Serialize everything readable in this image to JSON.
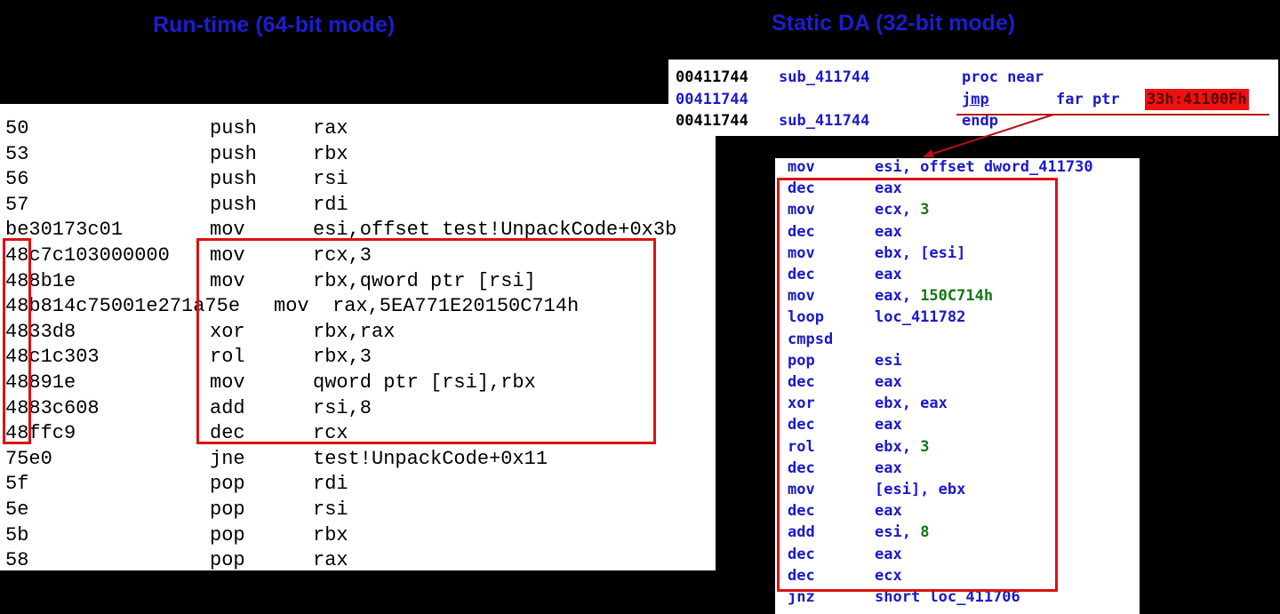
{
  "titles": {
    "left": "Run-time (64-bit mode)",
    "right": "Static DA (32-bit mode)"
  },
  "runtime_rows": [
    {
      "bytes": "50",
      "mnemonic": "push",
      "operands": "rax"
    },
    {
      "bytes": "53",
      "mnemonic": "push",
      "operands": "rbx"
    },
    {
      "bytes": "56",
      "mnemonic": "push",
      "operands": "rsi"
    },
    {
      "bytes": "57",
      "mnemonic": "push",
      "operands": "rdi"
    },
    {
      "bytes": "be30173c01",
      "mnemonic": "mov",
      "operands": "esi,offset test!UnpackCode+0x3b"
    },
    {
      "bytes": "48c7c103000000",
      "mnemonic": "mov",
      "operands": "rcx,3"
    },
    {
      "bytes": "488b1e",
      "mnemonic": "mov",
      "operands": "rbx,qword ptr [rsi]"
    },
    {
      "bytes": "48b814c75001e271a75e",
      "mnemonic": "mov",
      "operands": "rax,5EA771E20150C714h"
    },
    {
      "bytes": "4833d8",
      "mnemonic": "xor",
      "operands": "rbx,rax"
    },
    {
      "bytes": "48c1c303",
      "mnemonic": "rol",
      "operands": "rbx,3"
    },
    {
      "bytes": "48891e",
      "mnemonic": "mov",
      "operands": "qword ptr [rsi],rbx"
    },
    {
      "bytes": "4883c608",
      "mnemonic": "add",
      "operands": "rsi,8"
    },
    {
      "bytes": "48ffc9",
      "mnemonic": "dec",
      "operands": "rcx"
    },
    {
      "bytes": "75e0",
      "mnemonic": "jne",
      "operands": "test!UnpackCode+0x11"
    },
    {
      "bytes": "5f",
      "mnemonic": "pop",
      "operands": "rdi"
    },
    {
      "bytes": "5e",
      "mnemonic": "pop",
      "operands": "rsi"
    },
    {
      "bytes": "5b",
      "mnemonic": "pop",
      "operands": "rbx"
    },
    {
      "bytes": "58",
      "mnemonic": "pop",
      "operands": "rax"
    }
  ],
  "ida_top_rows": [
    {
      "addr": "00411744",
      "label": "sub_411744",
      "mnemonic": "proc near",
      "operand": ""
    },
    {
      "addr": "00411744",
      "label": "",
      "mnemonic": "jmp",
      "operand": "far ptr",
      "segment": "33h:41100Fh"
    },
    {
      "addr": "00411744",
      "label": "sub_411744",
      "mnemonic": "endp",
      "operand": ""
    }
  ],
  "ida_bottom_rows": [
    {
      "mnemonic": "mov",
      "operands": "esi, offset dword_411730"
    },
    {
      "mnemonic": "dec",
      "operands": "eax"
    },
    {
      "mnemonic": "mov",
      "operands": "ecx, ",
      "num": "3"
    },
    {
      "mnemonic": "dec",
      "operands": "eax"
    },
    {
      "mnemonic": "mov",
      "operands": "ebx, [esi]"
    },
    {
      "mnemonic": "dec",
      "operands": "eax"
    },
    {
      "mnemonic": "mov",
      "operands": "eax, ",
      "num": "150C714h"
    },
    {
      "mnemonic": "loop",
      "operands": "loc_411782"
    },
    {
      "mnemonic": "cmpsd",
      "operands": ""
    },
    {
      "mnemonic": "pop",
      "operands": "esi"
    },
    {
      "mnemonic": "dec",
      "operands": "eax"
    },
    {
      "mnemonic": "xor",
      "operands": "ebx, eax"
    },
    {
      "mnemonic": "dec",
      "operands": "eax"
    },
    {
      "mnemonic": "rol",
      "operands": "ebx, ",
      "num": "3"
    },
    {
      "mnemonic": "dec",
      "operands": "eax"
    },
    {
      "mnemonic": "mov",
      "operands": "[esi], ebx"
    },
    {
      "mnemonic": "dec",
      "operands": "eax"
    },
    {
      "mnemonic": "add",
      "operands": "esi, ",
      "num": "8"
    },
    {
      "mnemonic": "dec",
      "operands": "eax"
    },
    {
      "mnemonic": "dec",
      "operands": "ecx"
    },
    {
      "mnemonic": "jnz",
      "operands": "short loc_411706"
    }
  ],
  "colors": {
    "title": "#1d1dcc",
    "highlight_box": "#dd1111",
    "ida_text": "#1a1acc",
    "ida_number": "#117711",
    "segment_bg": "#ee1111"
  }
}
